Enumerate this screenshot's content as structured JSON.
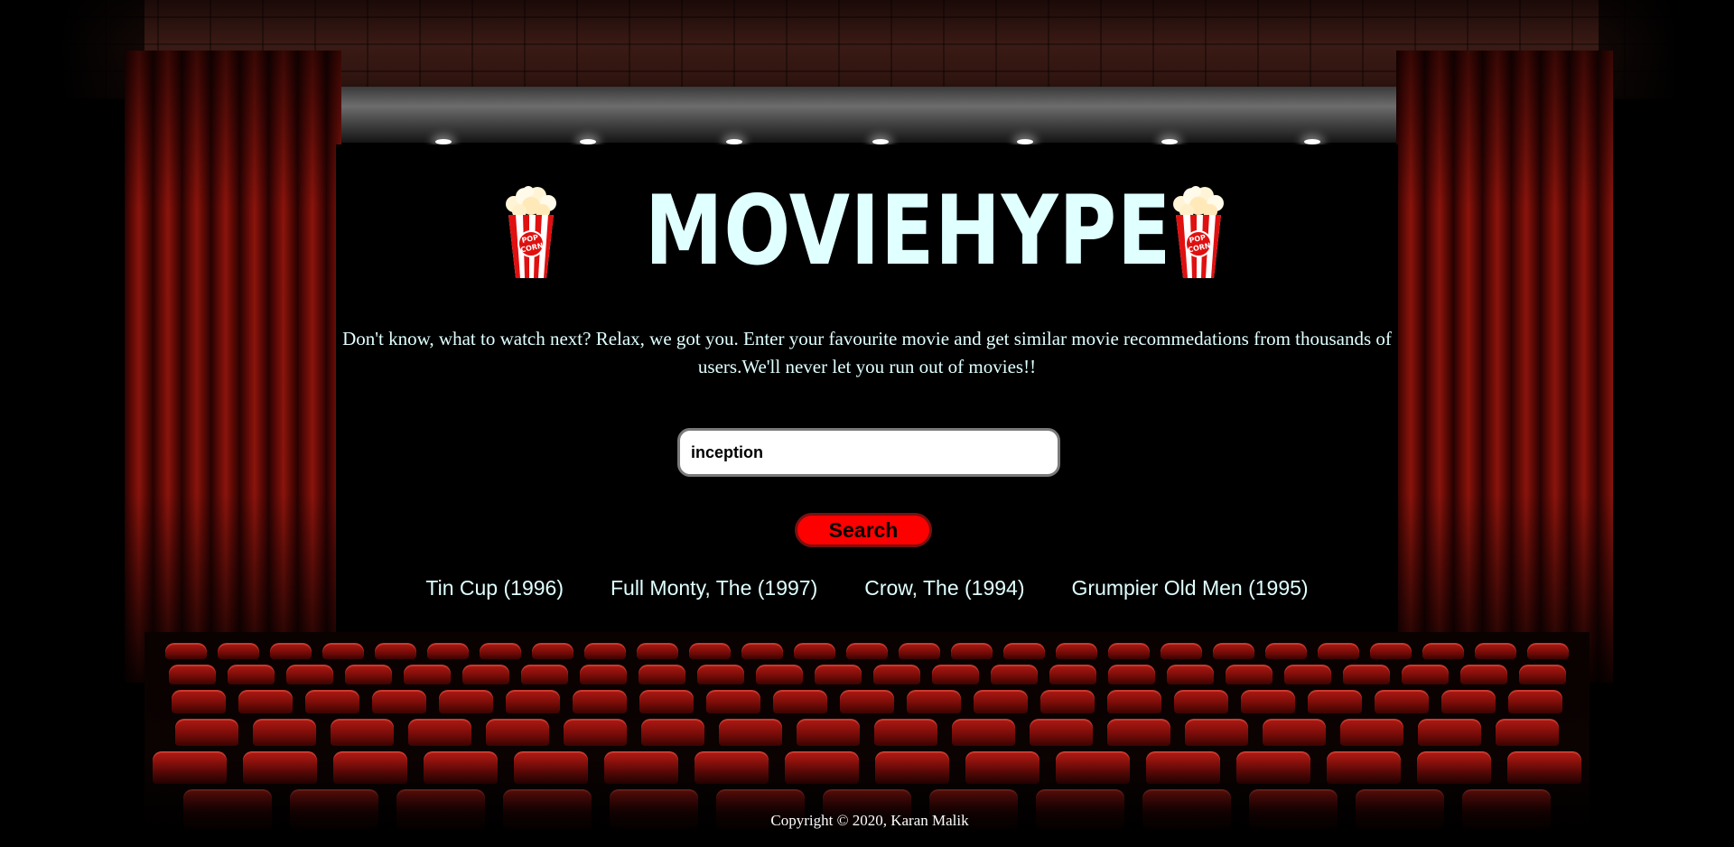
{
  "brand": {
    "title": "MOVIEHYPE",
    "popcorn_label": "POP CORN"
  },
  "intro": {
    "text": "Don't know, what to watch next? Relax, we got you. Enter your favourite movie and get similar movie recommedations from thousands of users.We'll never let you run out of movies!!"
  },
  "search": {
    "value": "inception",
    "button_label": "Search"
  },
  "results": [
    "Tin Cup (1996)",
    "Full Monty, The (1997)",
    "Crow, The (1994)",
    "Grumpier Old Men (1995)"
  ],
  "footer": {
    "copyright": "Copyright © 2020, Karan Malik"
  },
  "colors": {
    "accent_text": "#e0ffff",
    "button_bg": "#ff0000",
    "curtain": "#8a140c",
    "background": "#000000"
  },
  "icons": [
    "popcorn-icon"
  ]
}
